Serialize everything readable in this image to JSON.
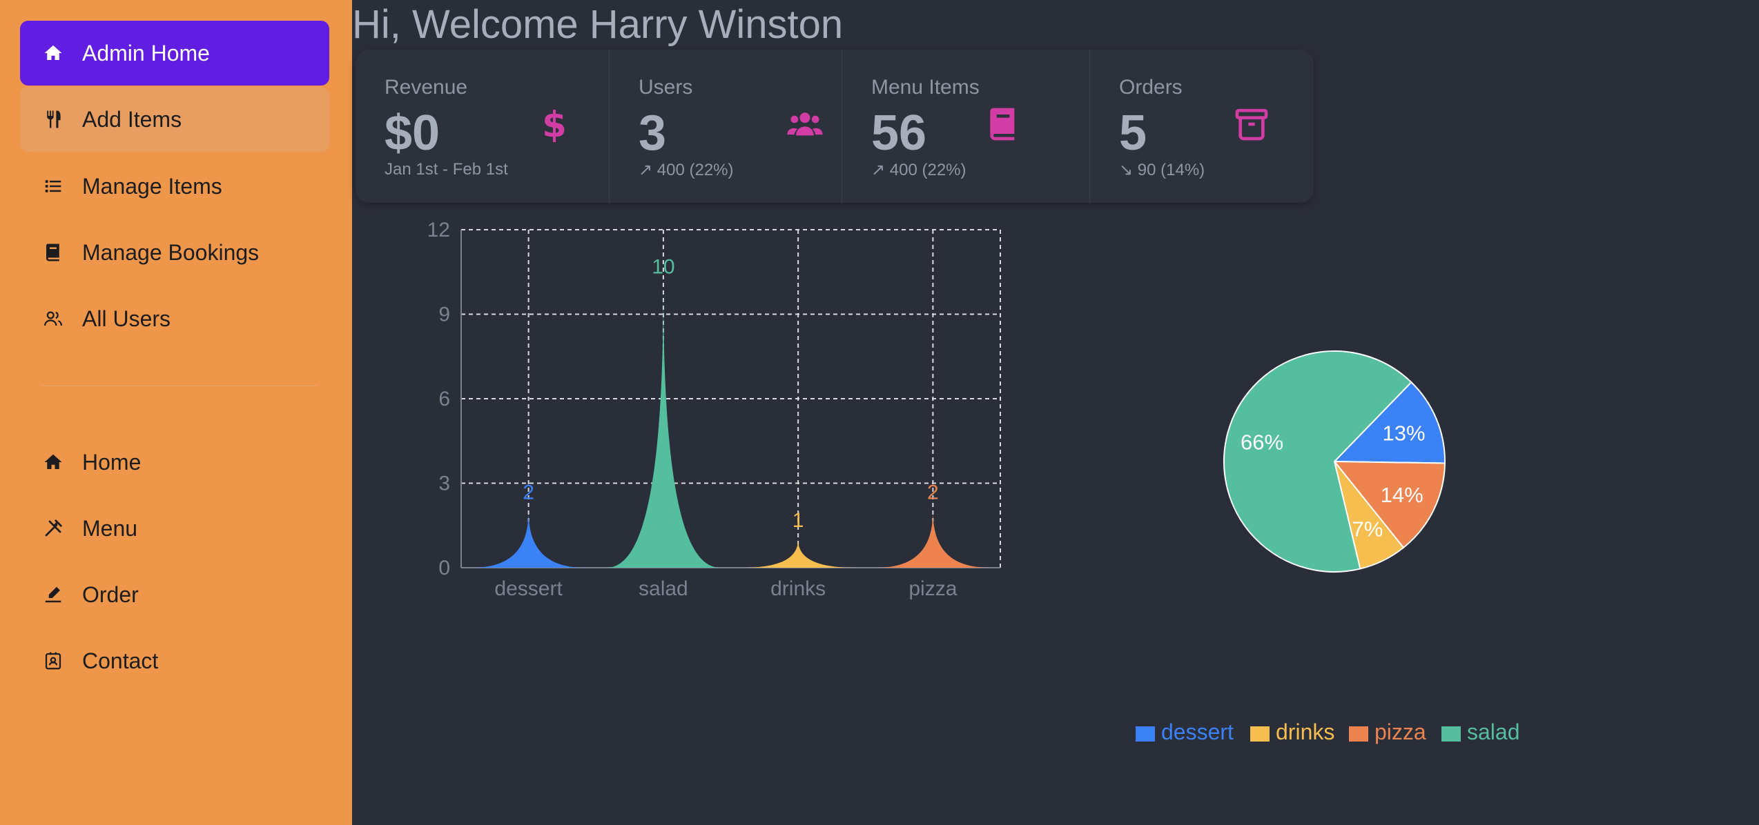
{
  "sidebar": {
    "items": [
      {
        "label": "Admin Home"
      },
      {
        "label": "Add Items"
      },
      {
        "label": "Manage Items"
      },
      {
        "label": "Manage Bookings"
      },
      {
        "label": "All Users"
      },
      {
        "label": "Home"
      },
      {
        "label": "Menu"
      },
      {
        "label": "Order"
      },
      {
        "label": "Contact"
      }
    ]
  },
  "welcome": "Hi, Welcome Harry Winston",
  "stats": [
    {
      "title": "Revenue",
      "value": "$0",
      "desc": "Jan 1st - Feb 1st",
      "icon": "dollar-icon"
    },
    {
      "title": "Users",
      "value": "3",
      "desc": "↗︎ 400 (22%)",
      "icon": "users-icon"
    },
    {
      "title": "Menu Items",
      "value": "56",
      "desc": "↗︎ 400 (22%)",
      "icon": "book-icon"
    },
    {
      "title": "Orders",
      "value": "5",
      "desc": "↘︎ 90 (14%)",
      "icon": "archive-icon"
    }
  ],
  "colors": {
    "sidebar": "#ee974a",
    "active": "#621de3",
    "background": "#2a2e38",
    "stat_icon": "#d13da5",
    "dessert": "#3b82f6",
    "salad": "#54be9e",
    "drinks": "#f5be4f",
    "pizza": "#ed8450"
  },
  "chart_data": [
    {
      "type": "bar",
      "categories": [
        "dessert",
        "salad",
        "drinks",
        "pizza"
      ],
      "values": [
        2,
        10,
        1,
        2
      ],
      "ylim": [
        0,
        12
      ],
      "yticks": [
        0,
        3,
        6,
        9,
        12
      ],
      "grid": true,
      "colors": [
        "#3b82f6",
        "#54be9e",
        "#f5be4f",
        "#ed8450"
      ]
    },
    {
      "type": "pie",
      "slices": [
        {
          "label": "dessert",
          "value": 13,
          "text": "13%",
          "color": "#3b82f6"
        },
        {
          "label": "pizza",
          "value": 14,
          "text": "14%",
          "color": "#ed8450"
        },
        {
          "label": "drinks",
          "value": 7,
          "text": "7%",
          "color": "#f5be4f"
        },
        {
          "label": "salad",
          "value": 66,
          "text": "66%",
          "color": "#54be9e"
        }
      ],
      "legend": {
        "position": "bottom",
        "items": [
          {
            "label": "dessert",
            "color": "#3b82f6"
          },
          {
            "label": "drinks",
            "color": "#f5be4f"
          },
          {
            "label": "pizza",
            "color": "#ed8450"
          },
          {
            "label": "salad",
            "color": "#54be9e"
          }
        ]
      }
    }
  ]
}
